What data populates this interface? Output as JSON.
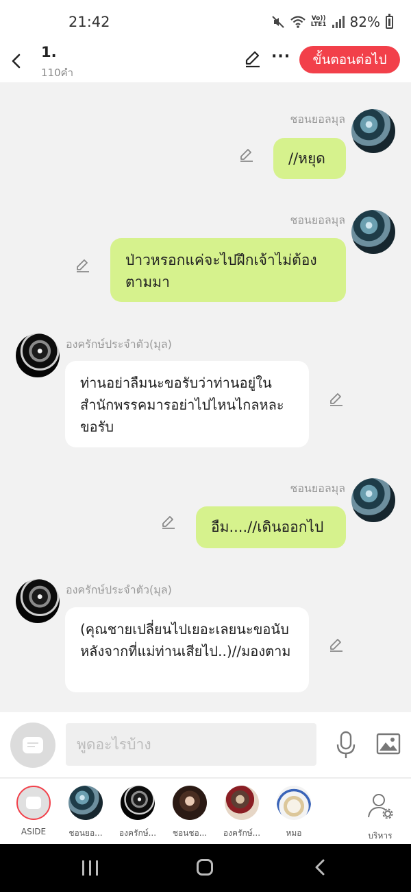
{
  "status_bar": {
    "time": "21:42",
    "network": "Vo))\nLTE1",
    "battery": "82%"
  },
  "header": {
    "title": "1.",
    "subtitle": "110คำ",
    "next_label": "ขั้นตอนต่อไป"
  },
  "messages": [
    {
      "side": "me",
      "sender": "ชอนยอลมุล",
      "text": "//หยุด"
    },
    {
      "side": "me",
      "sender": "ชอนยอลมุล",
      "text": "ป่าวหรอกแค่จะไปฝึกเจ้าไม่ต้องตามมา"
    },
    {
      "side": "other",
      "sender": "องครักษ์ประจำตัว(มุล)",
      "text": "ท่านอย่าลืมนะขอรับว่าท่านอยู่ในสำนักพรรคมารอย่าไปไหนไกลหละขอรับ"
    },
    {
      "side": "me",
      "sender": "ชอนยอลมุล",
      "text": "อืม....//เดินออกไป"
    },
    {
      "side": "other",
      "sender": "องครักษ์ประจำตัว(มุล)",
      "text": "(คุณชายเปลี่ยนไปเยอะเลยนะขอนับหลังจากที่แม่ท่านเสียไป..)//มองตาม"
    }
  ],
  "input": {
    "placeholder": "พูดอะไรบ้าง"
  },
  "tray": {
    "items": [
      {
        "label": "ASIDE"
      },
      {
        "label": "ชอนยอ..."
      },
      {
        "label": "องครักษ์..."
      },
      {
        "label": "ชอนชอ..."
      },
      {
        "label": "องครักษ์..."
      },
      {
        "label": "หมอ"
      }
    ],
    "manage_label": "บริหาร"
  },
  "colors": {
    "accent": "#f2404a",
    "my_bubble": "#d6f28d",
    "other_bubble": "#ffffff",
    "background": "#f2f2f2"
  }
}
